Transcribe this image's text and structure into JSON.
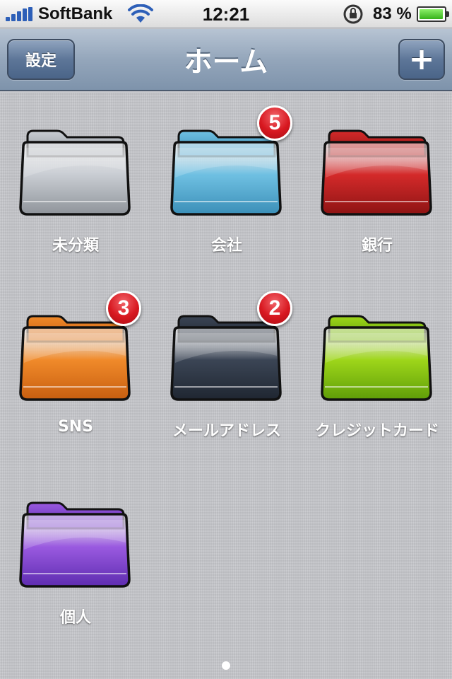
{
  "status_bar": {
    "carrier": "SoftBank",
    "time": "12:21",
    "battery_percent": "83 %",
    "battery_level": 0.83
  },
  "nav": {
    "title": "ホーム",
    "settings_label": "設定",
    "add_label": "+"
  },
  "folders": [
    {
      "label": "未分類",
      "color": "#c9cdd3",
      "dark": "#8f949b",
      "badge": ""
    },
    {
      "label": "会社",
      "color": "#6fc0e2",
      "dark": "#3b8fb8",
      "badge": "5"
    },
    {
      "label": "銀行",
      "color": "#d42a2a",
      "dark": "#8e1414",
      "badge": ""
    },
    {
      "label": "SNS",
      "color": "#f08a2a",
      "dark": "#c75e10",
      "badge": "3"
    },
    {
      "label": "メールアドレス",
      "color": "#3b4555",
      "dark": "#1f2631",
      "badge": "2"
    },
    {
      "label": "クレジットカード",
      "color": "#9ed61a",
      "dark": "#5f9d08",
      "badge": ""
    },
    {
      "label": "個人",
      "color": "#9a5ae0",
      "dark": "#5e2cb0",
      "badge": ""
    }
  ],
  "colors": {
    "navbar": "#7e93ab",
    "badge": "#d81820",
    "background": "#c6c7cb"
  }
}
